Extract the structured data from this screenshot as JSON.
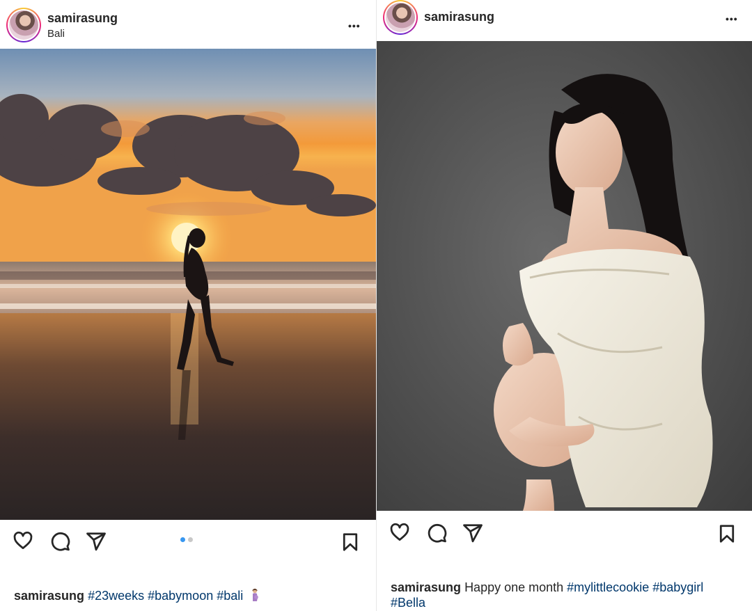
{
  "post1": {
    "username": "samirasung",
    "location": "Bali",
    "more_label": "•••",
    "carousel": {
      "count": 2,
      "active": 0
    },
    "caption": {
      "user": "samirasung",
      "tags": [
        "#23weeks",
        "#babymoon",
        "#bali"
      ],
      "emoji": "pregnant-person-emoji"
    },
    "icons": [
      "heart-icon",
      "comment-icon",
      "share-icon",
      "bookmark-icon"
    ]
  },
  "post2": {
    "username": "samirasung",
    "more_label": "•••",
    "caption": {
      "user": "samirasung",
      "text": "Happy one month",
      "tags": [
        "#mylittlecookie",
        "#babygirl"
      ],
      "tags_line2": [
        "#Bella"
      ]
    },
    "icons": [
      "heart-icon",
      "comment-icon",
      "share-icon",
      "bookmark-icon"
    ]
  },
  "colors": {
    "text": "#262626",
    "hashtag": "#00376b",
    "carousel_active": "#3897f0",
    "carousel_inactive": "#c8c8c8"
  }
}
